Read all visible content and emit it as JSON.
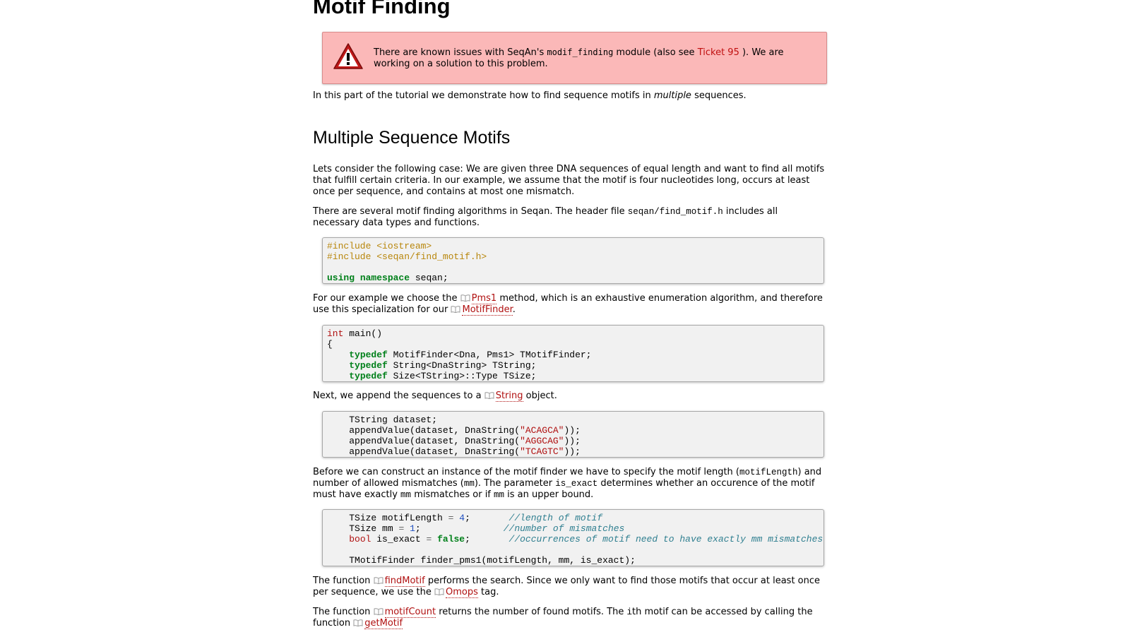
{
  "title": "Motif Finding",
  "warning": {
    "text_before": "There are known issues with SeqAn's ",
    "code": "modif_finding",
    "text_middle": " module (also see ",
    "link": "Ticket 95",
    "text_after": " ). We are working on a solution to this problem."
  },
  "intro": {
    "before": "In this part of the tutorial we demonstrate how to find sequence motifs in ",
    "em": "multiple",
    "after": " sequences."
  },
  "section_title": "Multiple Sequence Motifs",
  "para1": "Lets consider the following case: We are given three DNA sequences of equal length and want to find all motifs that fulfill certain criteria. In our example, we assume that the motif is four nucleotides long, occurs at least once per sequence, and contains at most one mismatch.",
  "para2": {
    "before": "There are several motif finding algorithms in Seqan. The header file ",
    "code": "seqan/find_motif.h",
    "after": " includes all necessary data types and functions."
  },
  "para3": {
    "before": "For our example we choose the ",
    "link1": "Pms1",
    "middle": " method, which is an exhaustive enumeration algorithm, and therefore use this specialization for our ",
    "link2": "MotifFinder",
    "after": "."
  },
  "para4": {
    "before": "Next, we append the sequences to a ",
    "link": "String",
    "after": " object."
  },
  "para5": {
    "t1": "Before we can construct an instance of the motif finder we have to specify the motif length (",
    "c1": "motifLength",
    "t2": ") and number of allowed mismatches (",
    "c2": "mm",
    "t3": "). The parameter ",
    "c3": "is_exact",
    "t4": " determines whether an occurence of the motif must have exactly ",
    "c4": "mm",
    "t5": " mismatches or if ",
    "c5": "mm",
    "t6": " is an upper bound."
  },
  "para6": {
    "before": "The function ",
    "link1": "findMotif",
    "middle": " performs the search. Since we only want to find those motifs that occur at least once per sequence, we use the ",
    "link2": "Omops",
    "after": " tag."
  },
  "para7": {
    "before": "The function ",
    "link1": "motifCount",
    "middle": " returns the number of found motifs. The ",
    "code": "i",
    "middle2": "th motif can be accessed by calling the function ",
    "link2": "getMotif"
  },
  "code1": {
    "l1": "#include <iostream>",
    "l2": "#include <seqan/find_motif.h>",
    "kw1": "using",
    "kw2": "namespace",
    "rest": " seqan;"
  },
  "code2": {
    "int": "int",
    "main": " main()",
    "brace": "{",
    "typedef": "typedef",
    "l1": " MotifFinder<Dna, Pms1> TMotifFinder;",
    "l2": " String<DnaString> TString;",
    "l3": " Size<TString>::Type TSize;"
  },
  "code3": {
    "decl": "TString dataset;",
    "call": "appendValue(dataset, DnaString(",
    "s1": "\"ACAGCA\"",
    "s2": "\"AGGCAG\"",
    "s3": "\"TCAGTC\"",
    "end": "));"
  },
  "code4": {
    "l1a": "TSize motifLength ",
    "eq": "=",
    "n1": "4",
    "semi": ";",
    "c1": "//length of motif",
    "l2a": "TSize mm ",
    "n2": "1",
    "c2": "//number of mismatches",
    "bool": "bool",
    "l3a": " is_exact ",
    "false": "false",
    "c3": "//occurrences of motif need to have exactly mm mismatches",
    "l5": "TMotifFinder finder_pms1(motifLength, mm, is_exact);"
  }
}
